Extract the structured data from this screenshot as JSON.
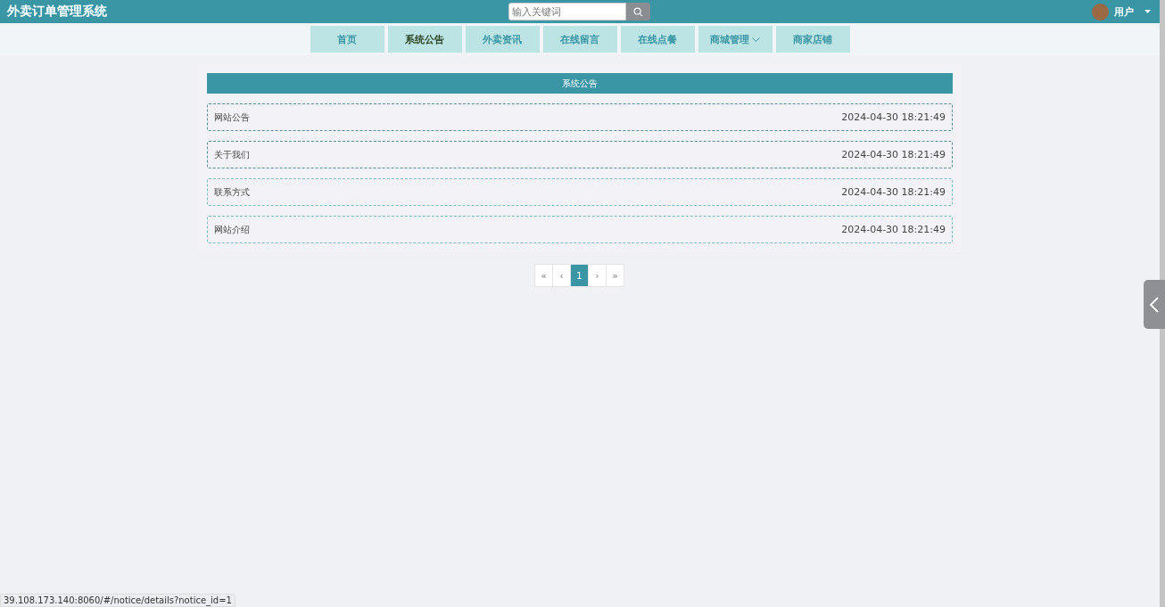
{
  "header": {
    "title": "外卖订单管理系统",
    "search": {
      "placeholder": "输入关键词"
    },
    "user": {
      "name": "用户"
    }
  },
  "nav": [
    {
      "label": "首页",
      "selected": false
    },
    {
      "label": "系统公告",
      "selected": true
    },
    {
      "label": "外卖资讯",
      "selected": false
    },
    {
      "label": "在线留言",
      "selected": false
    },
    {
      "label": "在线点餐",
      "selected": false
    },
    {
      "label": "商城管理",
      "selected": false,
      "kind": "dropdown"
    },
    {
      "label": "商家店铺",
      "selected": false
    }
  ],
  "panel": {
    "title": "系统公告",
    "notices": [
      {
        "title": "网站公告",
        "time": "2024-04-30 18:21:49"
      },
      {
        "title": "关于我们",
        "time": "2024-04-30 18:21:49"
      },
      {
        "title": "联系方式",
        "time": "2024-04-30 18:21:49"
      },
      {
        "title": "网站介绍",
        "time": "2024-04-30 18:21:49"
      }
    ]
  },
  "pagination": [
    {
      "label": "«",
      "selected": false
    },
    {
      "label": "‹",
      "selected": false
    },
    {
      "label": "1",
      "selected": true
    },
    {
      "label": "›",
      "selected": false
    },
    {
      "label": "»",
      "selected": false
    }
  ],
  "status_bar": {
    "url": "39.108.173.140:8060/#/notice/details?notice_id=1"
  }
}
